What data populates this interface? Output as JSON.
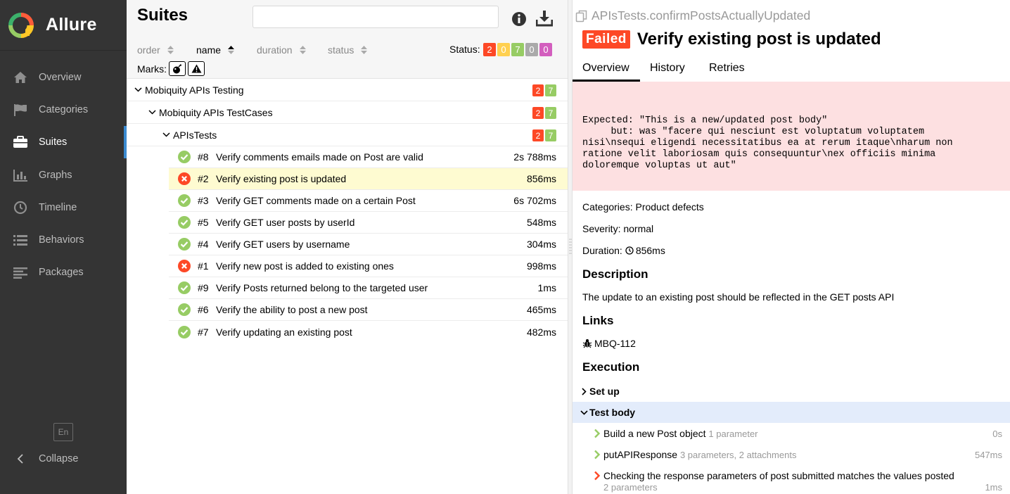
{
  "app": {
    "name": "Allure",
    "lang": "En"
  },
  "colors": {
    "failed": "#fd4826",
    "broken": "#ffd050",
    "passed": "#97cc64",
    "skipped": "#aaaaaa",
    "unknown": "#d35ebe",
    "sidebar_bg": "#343434",
    "accent": "#3a8ad0"
  },
  "sidebar": {
    "items": [
      {
        "label": "Overview",
        "icon": "home-icon"
      },
      {
        "label": "Categories",
        "icon": "flag-icon"
      },
      {
        "label": "Suites",
        "icon": "briefcase-icon",
        "active": true
      },
      {
        "label": "Graphs",
        "icon": "bar-chart-icon"
      },
      {
        "label": "Timeline",
        "icon": "clock-icon"
      },
      {
        "label": "Behaviors",
        "icon": "list-icon"
      },
      {
        "label": "Packages",
        "icon": "align-left-icon"
      }
    ],
    "collapse_label": "Collapse"
  },
  "suites": {
    "title": "Suites",
    "search_placeholder": "",
    "sort": {
      "order": "order",
      "name": "name",
      "duration": "duration",
      "status": "status"
    },
    "status_label": "Status:",
    "status_counts": {
      "failed": "2",
      "broken": "0",
      "passed": "7",
      "skipped": "0",
      "unknown": "0"
    },
    "marks_label": "Marks:",
    "groups": [
      {
        "label": "Mobiquity APIs Testing",
        "failed": "2",
        "passed": "7"
      },
      {
        "label": "Mobiquity APIs TestCases",
        "failed": "2",
        "passed": "7"
      },
      {
        "label": "APIsTests",
        "failed": "2",
        "passed": "7"
      }
    ],
    "tests": [
      {
        "num": "#8",
        "name": "Verify comments emails made on Post are valid",
        "duration": "2s 788ms",
        "status": "passed"
      },
      {
        "num": "#2",
        "name": "Verify existing post is updated",
        "duration": "856ms",
        "status": "failed",
        "selected": true
      },
      {
        "num": "#3",
        "name": "Verify GET comments made on a certain Post",
        "duration": "6s 702ms",
        "status": "passed"
      },
      {
        "num": "#5",
        "name": "Verify GET user posts by userId",
        "duration": "548ms",
        "status": "passed"
      },
      {
        "num": "#4",
        "name": "Verify GET users by username",
        "duration": "304ms",
        "status": "passed"
      },
      {
        "num": "#1",
        "name": "Verify new post is added to existing ones",
        "duration": "998ms",
        "status": "failed"
      },
      {
        "num": "#9",
        "name": "Verify Posts returned belong to the targeted user",
        "duration": "1ms",
        "status": "passed"
      },
      {
        "num": "#6",
        "name": "Verify the ability to post a new post",
        "duration": "465ms",
        "status": "passed"
      },
      {
        "num": "#7",
        "name": "Verify updating an existing post",
        "duration": "482ms",
        "status": "passed"
      }
    ]
  },
  "detail": {
    "full_name": "APIsTests.confirmPostsActuallyUpdated",
    "status_badge": "Failed",
    "title": "Verify existing post is updated",
    "tabs": [
      "Overview",
      "History",
      "Retries"
    ],
    "error": "Expected: \"This is a new/updated post body\"\n     but: was \"facere qui nesciunt est voluptatum voluptatem\nnisi\\nsequi eligendi necessitatibus ea at rerum itaque\\nharum non\nratione velit laboriosam quis consequuntur\\nex officiis minima\ndoloremque voluptas ut aut\"",
    "categories": "Categories: Product defects",
    "severity": "Severity: normal",
    "duration_label": "Duration:",
    "duration": "856ms",
    "description_heading": "Description",
    "description": "The update to an existing post should be reflected in the GET posts API",
    "links_heading": "Links",
    "link": "MBQ-112",
    "execution_heading": "Execution",
    "setup_label": "Set up",
    "test_body_label": "Test body",
    "steps": [
      {
        "name": "Build a new Post object",
        "meta": "1 parameter",
        "duration": "0s",
        "status": "passed"
      },
      {
        "name": "putAPIResponse",
        "meta": "3 parameters, 2 attachments",
        "duration": "547ms",
        "status": "passed"
      },
      {
        "name": "Checking the response parameters of post submitted matches the values posted",
        "meta": "2 parameters",
        "duration": "1ms",
        "status": "failed"
      }
    ]
  }
}
